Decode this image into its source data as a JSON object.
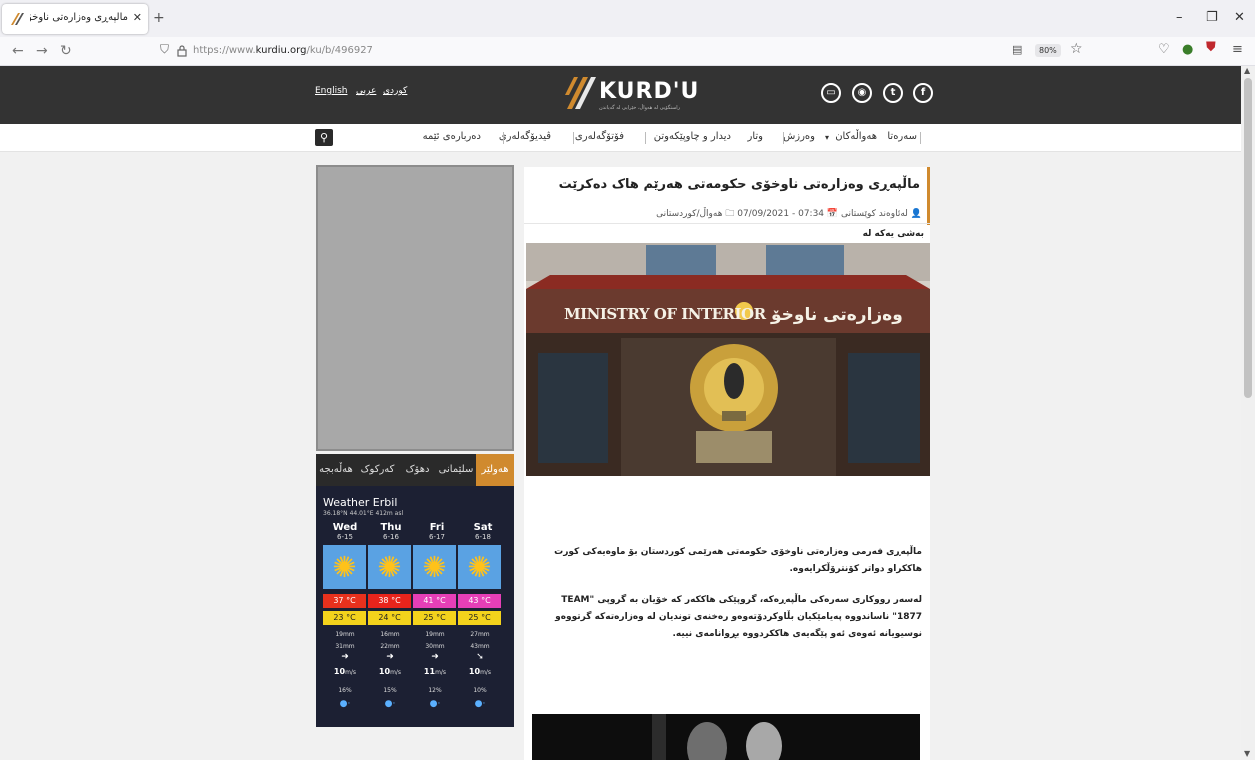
{
  "browser": {
    "tab_title": "ماڵپەڕی وەزارەتی ناوخۆی حکومەتی",
    "url_prefix": "https://www.",
    "url_domain": "kurdiu.org",
    "url_path": "/ku/b/496927",
    "zoom": "80%"
  },
  "header": {
    "lang_kurdish": "کوردی",
    "lang_arabic": "عربي",
    "lang_english": "English",
    "logo_text": "KURD'U",
    "logo_tagline": "راستگۆیی لە هەواڵ، خێرایی لە گەیاندن"
  },
  "menu": {
    "items": [
      "سەرەتا",
      "هەواڵەکان",
      "وەرزش",
      "وتار",
      "دیدار و چاوپێکەوتن",
      "فۆتۆگەلەری",
      "ڤیدیۆگەلەری",
      "دەربارەی ئێمە"
    ]
  },
  "weather": {
    "tabs": [
      "هەولێر",
      "سلێمانی",
      "دهۆک",
      "کەرکوک",
      "هەڵەبجە"
    ],
    "title": "Weather Erbil",
    "coords": "36.18°N 44.01°E 412m asl",
    "days": [
      {
        "day": "Wed",
        "date": "6-15",
        "max": "37 °C",
        "min": "23 °C",
        "l1": "19mm",
        "l2": "31mm",
        "arrow": "➜",
        "wind": "10",
        "wind_unit": "m/s",
        "humid": "16%",
        "drop": "💧"
      },
      {
        "day": "Thu",
        "date": "6-16",
        "max": "38 °C",
        "min": "24 °C",
        "l1": "16mm",
        "l2": "22mm",
        "arrow": "➜",
        "wind": "10",
        "wind_unit": "m/s",
        "humid": "15%",
        "drop": "💧"
      },
      {
        "day": "Fri",
        "date": "6-17",
        "max": "41 °C",
        "min": "25 °C",
        "l1": "19mm",
        "l2": "30mm",
        "arrow": "➜",
        "wind": "11",
        "wind_unit": "m/s",
        "humid": "12%",
        "drop": "💧"
      },
      {
        "day": "Sat",
        "date": "6-18",
        "max": "43 °C",
        "min": "25 °C",
        "l1": "27mm",
        "l2": "43mm",
        "arrow": "➘",
        "wind": "10",
        "wind_unit": "m/s",
        "humid": "10%",
        "drop": "💧"
      }
    ]
  },
  "article": {
    "title": "ماڵپەڕی وەزارەتی ناوخۆی حکومەتی هەرێم هاک دەکرێت",
    "author": "لەئاوەند کوێستانی",
    "datetime": "07:34 - 07/09/2021",
    "category": "هەواڵ/کوردستانی",
    "kicker": "بەشی یەکە لە",
    "image_sign_en": "MINISTRY OF INTERIOR",
    "image_sign_ku": "وەزارەتی ناوخۆ",
    "para1": "ماڵپەڕی فەرمی وەزارەتی ناوخۆی حکومەتی هەرێمی کوردستان بۆ ماوەیەکی کورت هاککراو دواتر کۆنترۆڵکرایەوە.",
    "para2": "لەسەر رووکاری سەرەکی ماڵپەڕەکە، گروپێکی هاککەر کە خۆیان بە گروپی \"TEAM 1877\" ناساندووە پەیامێکیان بڵاوکردۆتەوەو رەخنەی توندیان لە وەزارەتەکە گرتووەو نوسیویانە ئەوەی ئەو پێگەیەی هاککردووە بڕوانامەی نییە."
  }
}
